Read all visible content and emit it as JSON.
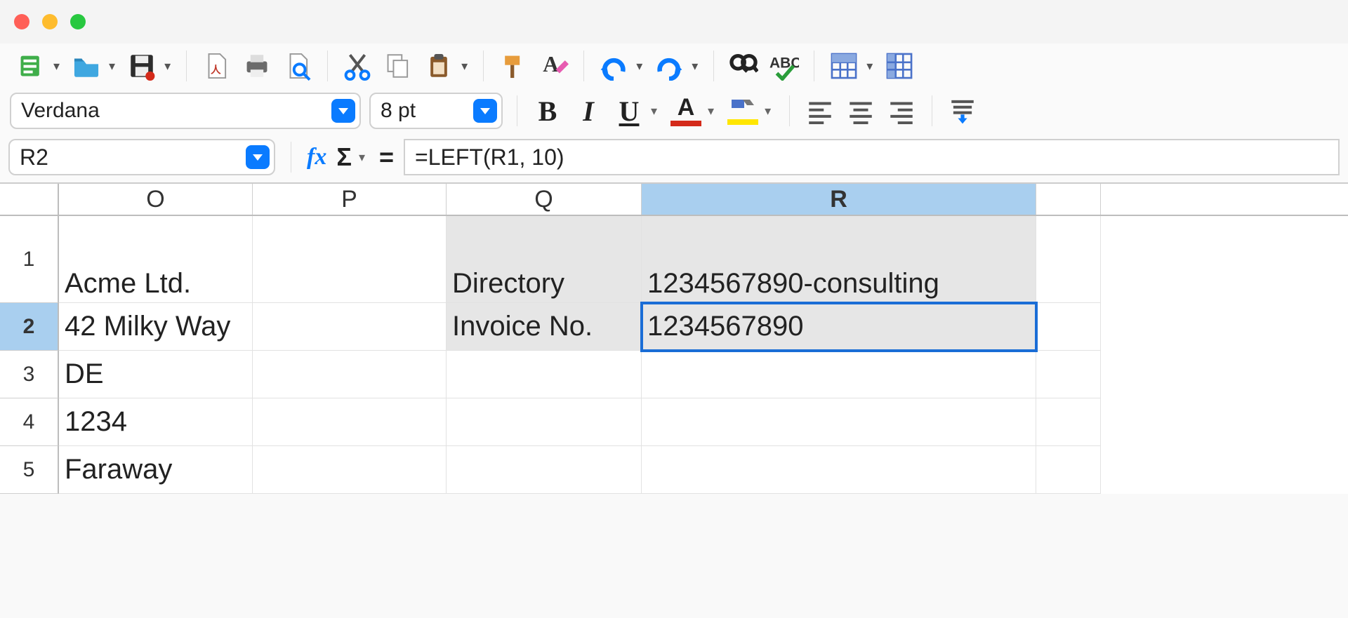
{
  "window": {
    "title": ""
  },
  "toolbar": {
    "icons": {
      "new": "new-spreadsheet",
      "open": "open",
      "save": "save",
      "pdf": "export-pdf",
      "print": "print",
      "preview": "print-preview",
      "cut": "cut",
      "copy": "copy",
      "paste": "paste",
      "clone_fmt": "clone-formatting",
      "clear_fmt": "clear-formatting",
      "undo": "undo",
      "redo": "redo",
      "find": "find-replace",
      "spell": "spellcheck",
      "grid": "toggle-grid",
      "freeze": "freeze-panes"
    }
  },
  "format_bar": {
    "font_name": "Verdana",
    "font_size": "8 pt",
    "font_color": "#d42a1a",
    "highlight_color": "#ffe600"
  },
  "formula_bar": {
    "cell_ref": "R2",
    "formula": "=LEFT(R1, 10)"
  },
  "grid": {
    "columns": [
      "O",
      "P",
      "Q",
      "R"
    ],
    "selected_column": "R",
    "selected_row": "2",
    "rows": {
      "r1": {
        "num": "1",
        "O": "Acme Ltd.",
        "P": "",
        "Q": "Directory",
        "R": "1234567890-consulting"
      },
      "r2": {
        "num": "2",
        "O": "42 Milky Way",
        "P": "",
        "Q": "Invoice No.",
        "R": "1234567890"
      },
      "r3": {
        "num": "3",
        "O": "DE",
        "P": "",
        "Q": "",
        "R": ""
      },
      "r4": {
        "num": "4",
        "O": "1234",
        "P": "",
        "Q": "",
        "R": ""
      },
      "r5": {
        "num": "5",
        "O": "Faraway",
        "P": "",
        "Q": "",
        "R": ""
      }
    }
  }
}
